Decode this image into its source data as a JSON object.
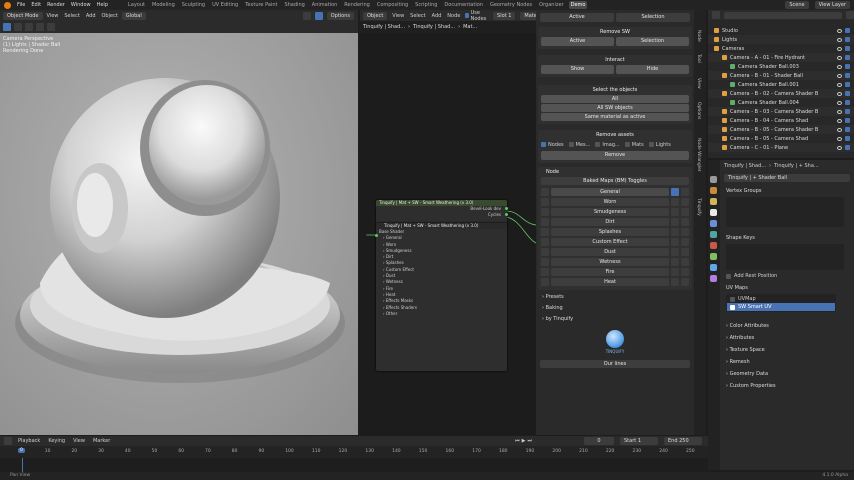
{
  "topbar": {
    "menus": [
      "File",
      "Edit",
      "Render",
      "Window",
      "Help"
    ],
    "workspaces": [
      "Layout",
      "Modeling",
      "Sculpting",
      "UV Editing",
      "Texture Paint",
      "Shading",
      "Animation",
      "Rendering",
      "Compositing",
      "Scripting",
      "Documentation",
      "Geometry Nodes",
      "Organizer",
      "Demo"
    ],
    "active_workspace": "Demo",
    "scene": "Scene",
    "view_layer": "View Layer"
  },
  "viewport": {
    "mode": "Object Mode",
    "menus": [
      "View",
      "Select",
      "Add",
      "Object"
    ],
    "transform": "Global",
    "options": "Options",
    "info_lines": [
      "Camera Perspective",
      "(1) Lights | Shader Ball",
      "Rendering Done"
    ]
  },
  "node_editor": {
    "type": "Object",
    "menus": [
      "View",
      "Select",
      "Add",
      "Node"
    ],
    "use_nodes": "Use Nodes",
    "slot": "Slot 1",
    "material": "Material",
    "breadcrumb": [
      "Tinquify | Shad...",
      "Tinquify | Shad...",
      "Mat..."
    ],
    "node_main": {
      "title": "Tinquify | Mat + SW - Smart Weathering (v 3.0)",
      "outputs": [
        "Bevel-Look dev",
        "Cycles"
      ]
    },
    "node_group": {
      "title": "Tinquify | Mat + SW - Smart Weathering (v 3.0)",
      "base_label": "Base Shader",
      "items": [
        "General",
        "Worn",
        "Smudgeness",
        "Dirt",
        "Splashes",
        "Custom Effect",
        "Dust",
        "Wetness",
        "Fire",
        "Heat",
        "Effects Masks",
        "Effects Shaders",
        "Other"
      ]
    }
  },
  "npanel": {
    "top_buttons": [
      "Active",
      "Selection"
    ],
    "remove_sw": {
      "title": "Remove SW",
      "buttons": [
        "Active",
        "Selection"
      ]
    },
    "interact": {
      "title": "Interact",
      "buttons": [
        "Show",
        "Hide"
      ]
    },
    "select_objects": {
      "title": "Select the objects",
      "buttons": [
        "All",
        "All SW objects",
        "Same material as active"
      ]
    },
    "remove_assets": {
      "title": "Remove assets",
      "checks": [
        "Nodes",
        "Mes...",
        "Imag...",
        "Mats",
        "Lights"
      ],
      "button": "Remove"
    },
    "node_section": {
      "title": "Node",
      "subtitle": "Baked Maps (BM) Toggles",
      "toggles": [
        "General",
        "Worn",
        "Smudgeness",
        "Dirt",
        "Splashes",
        "Custom Effect",
        "Dust",
        "Wetness",
        "Fire",
        "Heat"
      ]
    },
    "collapsed": [
      "Presets",
      "Baking",
      "by Tinquify"
    ],
    "brand": "TINQUIFY",
    "bottom_button": "Our lines",
    "vertical_tabs": [
      "Node",
      "Tool",
      "View",
      "Options",
      "Node Wrangler",
      "Tinquify"
    ]
  },
  "outliner": {
    "rows": [
      "Studio",
      "Lights",
      "Cameras",
      "Camera - A - 01 - Fire Hydrant",
      "Camera Shader Ball.003",
      "Camera - B - 01 - Shader Ball",
      "Camera Shader Ball.001",
      "Camera - B - 02 - Camera Shader B",
      "Camera Shader Ball.004",
      "Camera - B - 03 - Camera Shader B",
      "Camera - B - 04 - Camera Shad",
      "Camera - B - 05 - Camera Shader B",
      "Camera - B - 05 - Camera Shad",
      "Camera - C - 01 - Plane"
    ]
  },
  "properties": {
    "breadcrumb": [
      "Tinquify | Shad...",
      "Tinquify | + Sha..."
    ],
    "object_name": "Tinquify | + Shader Ball",
    "sections": {
      "vertex_groups": "Vertex Groups",
      "shape_keys": "Shape Keys",
      "add_rest": "Add Rest Position",
      "uv_maps": "UV Maps"
    },
    "uv_maps": [
      "UVMap",
      "SW Smart UV"
    ],
    "more_sections": [
      "Color Attributes",
      "Attributes",
      "Texture Space",
      "Remesh",
      "Geometry Data",
      "Custom Properties"
    ]
  },
  "timeline": {
    "menus": [
      "Playback",
      "Keying",
      "View",
      "Marker"
    ],
    "current": "0",
    "start_label": "Start",
    "start": "1",
    "end_label": "End",
    "end": "250",
    "ticks": [
      "0",
      "10",
      "20",
      "30",
      "40",
      "50",
      "60",
      "70",
      "80",
      "90",
      "100",
      "110",
      "120",
      "130",
      "140",
      "150",
      "160",
      "170",
      "180",
      "190",
      "200",
      "210",
      "220",
      "230",
      "240",
      "250"
    ]
  },
  "status": {
    "left": "Pan View",
    "right": "4.1.0 Alpha"
  },
  "colors": {
    "accent": "#4772b3",
    "active_workspace": "#4a4a4a",
    "node_header": "#3a4a2e",
    "socket": "#63c763"
  }
}
